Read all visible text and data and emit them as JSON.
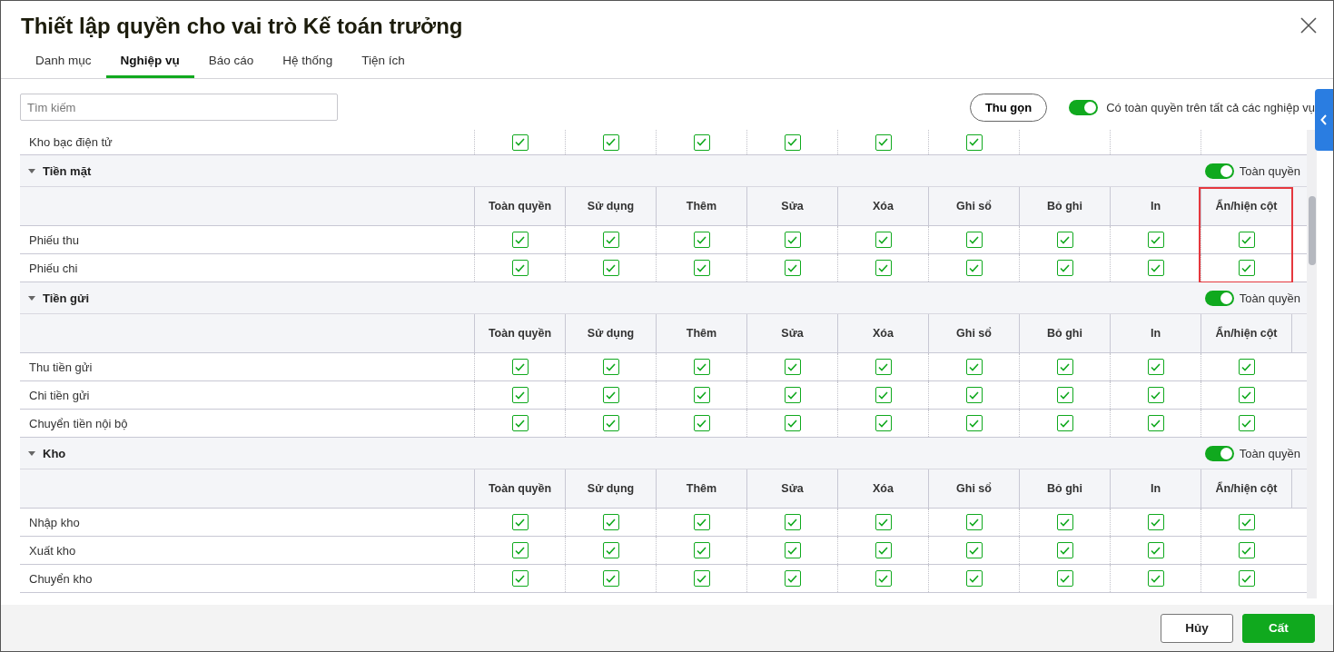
{
  "window": {
    "title": "Thiết lập quyền cho vai trò Kế toán trưởng"
  },
  "tabs": [
    {
      "label": "Danh mục",
      "selected": false
    },
    {
      "label": "Nghiệp vụ",
      "selected": true
    },
    {
      "label": "Báo cáo",
      "selected": false
    },
    {
      "label": "Hệ thống",
      "selected": false
    },
    {
      "label": "Tiện ích",
      "selected": false
    }
  ],
  "search": {
    "placeholder": "Tìm kiếm"
  },
  "collapse_button": "Thu gọn",
  "full_access_all": {
    "label": "Có toàn quyền trên tất cả các nghiệp vụ",
    "on": true
  },
  "top_row": {
    "name": "Kho bạc điện tử",
    "cells": [
      {
        "checked": true
      },
      {
        "checked": true
      },
      {
        "checked": true
      },
      {
        "checked": true
      },
      {
        "checked": true
      },
      {
        "checked": true
      }
    ]
  },
  "sections": [
    {
      "title": "Tiền mặt",
      "expanded": true,
      "toggle": {
        "label": "Toàn quyền",
        "on": true
      },
      "columns": [
        {
          "label": "Toàn quyền",
          "highlighted": false
        },
        {
          "label": "Sử dụng",
          "highlighted": false
        },
        {
          "label": "Thêm",
          "highlighted": false
        },
        {
          "label": "Sửa",
          "highlighted": false
        },
        {
          "label": "Xóa",
          "highlighted": false
        },
        {
          "label": "Ghi sổ",
          "highlighted": false
        },
        {
          "label": "Bỏ ghi",
          "highlighted": false
        },
        {
          "label": "In",
          "highlighted": false
        },
        {
          "label": "Ẩn/hiện cột",
          "highlighted": true
        }
      ],
      "rows": [
        {
          "name": "Phiếu thu",
          "cells": [
            {
              "checked": true
            },
            {
              "checked": true
            },
            {
              "checked": true
            },
            {
              "checked": true
            },
            {
              "checked": true
            },
            {
              "checked": true
            },
            {
              "checked": true
            },
            {
              "checked": true
            },
            {
              "checked": true
            }
          ]
        },
        {
          "name": "Phiếu chi",
          "cells": [
            {
              "checked": true
            },
            {
              "checked": true
            },
            {
              "checked": true
            },
            {
              "checked": true
            },
            {
              "checked": true
            },
            {
              "checked": true
            },
            {
              "checked": true
            },
            {
              "checked": true
            },
            {
              "checked": true
            }
          ]
        }
      ]
    },
    {
      "title": "Tiền gửi",
      "expanded": true,
      "toggle": {
        "label": "Toàn quyền",
        "on": true
      },
      "columns": [
        {
          "label": "Toàn quyền",
          "highlighted": false
        },
        {
          "label": "Sử dụng",
          "highlighted": false
        },
        {
          "label": "Thêm",
          "highlighted": false
        },
        {
          "label": "Sửa",
          "highlighted": false
        },
        {
          "label": "Xóa",
          "highlighted": false
        },
        {
          "label": "Ghi sổ",
          "highlighted": false
        },
        {
          "label": "Bỏ ghi",
          "highlighted": false
        },
        {
          "label": "In",
          "highlighted": false
        },
        {
          "label": "Ẩn/hiện cột",
          "highlighted": false
        }
      ],
      "rows": [
        {
          "name": "Thu tiền gửi",
          "cells": [
            {
              "checked": true
            },
            {
              "checked": true
            },
            {
              "checked": true
            },
            {
              "checked": true
            },
            {
              "checked": true
            },
            {
              "checked": true
            },
            {
              "checked": true
            },
            {
              "checked": true
            },
            {
              "checked": true
            }
          ]
        },
        {
          "name": "Chi tiền gửi",
          "cells": [
            {
              "checked": true
            },
            {
              "checked": true
            },
            {
              "checked": true
            },
            {
              "checked": true
            },
            {
              "checked": true
            },
            {
              "checked": true
            },
            {
              "checked": true
            },
            {
              "checked": true
            },
            {
              "checked": true
            }
          ]
        },
        {
          "name": "Chuyển tiền nội bộ",
          "cells": [
            {
              "checked": true
            },
            {
              "checked": true
            },
            {
              "checked": true
            },
            {
              "checked": true
            },
            {
              "checked": true
            },
            {
              "checked": true
            },
            {
              "checked": true
            },
            {
              "checked": true
            },
            {
              "checked": true
            }
          ]
        }
      ]
    },
    {
      "title": "Kho",
      "expanded": true,
      "toggle": {
        "label": "Toàn quyền",
        "on": true
      },
      "columns": [
        {
          "label": "Toàn quyền",
          "highlighted": false
        },
        {
          "label": "Sử dụng",
          "highlighted": false
        },
        {
          "label": "Thêm",
          "highlighted": false
        },
        {
          "label": "Sửa",
          "highlighted": false
        },
        {
          "label": "Xóa",
          "highlighted": false
        },
        {
          "label": "Ghi sổ",
          "highlighted": false
        },
        {
          "label": "Bỏ ghi",
          "highlighted": false
        },
        {
          "label": "In",
          "highlighted": false
        },
        {
          "label": "Ẩn/hiện cột",
          "highlighted": false
        }
      ],
      "rows": [
        {
          "name": "Nhập kho",
          "cells": [
            {
              "checked": true
            },
            {
              "checked": true
            },
            {
              "checked": true
            },
            {
              "checked": true
            },
            {
              "checked": true
            },
            {
              "checked": true
            },
            {
              "checked": true
            },
            {
              "checked": true
            },
            {
              "checked": true
            }
          ]
        },
        {
          "name": "Xuất kho",
          "cells": [
            {
              "checked": true
            },
            {
              "checked": true
            },
            {
              "checked": true
            },
            {
              "checked": true
            },
            {
              "checked": true
            },
            {
              "checked": true
            },
            {
              "checked": true
            },
            {
              "checked": true
            },
            {
              "checked": true
            }
          ]
        },
        {
          "name": "Chuyển kho",
          "cells": [
            {
              "checked": true
            },
            {
              "checked": true
            },
            {
              "checked": true
            },
            {
              "checked": true
            },
            {
              "checked": true
            },
            {
              "checked": true
            },
            {
              "checked": true
            },
            {
              "checked": true
            },
            {
              "checked": true
            }
          ]
        }
      ]
    }
  ],
  "footer": {
    "buttons": [
      {
        "label": "Hủy",
        "kind": "secondary"
      },
      {
        "label": "Cất",
        "kind": "primary"
      }
    ]
  }
}
